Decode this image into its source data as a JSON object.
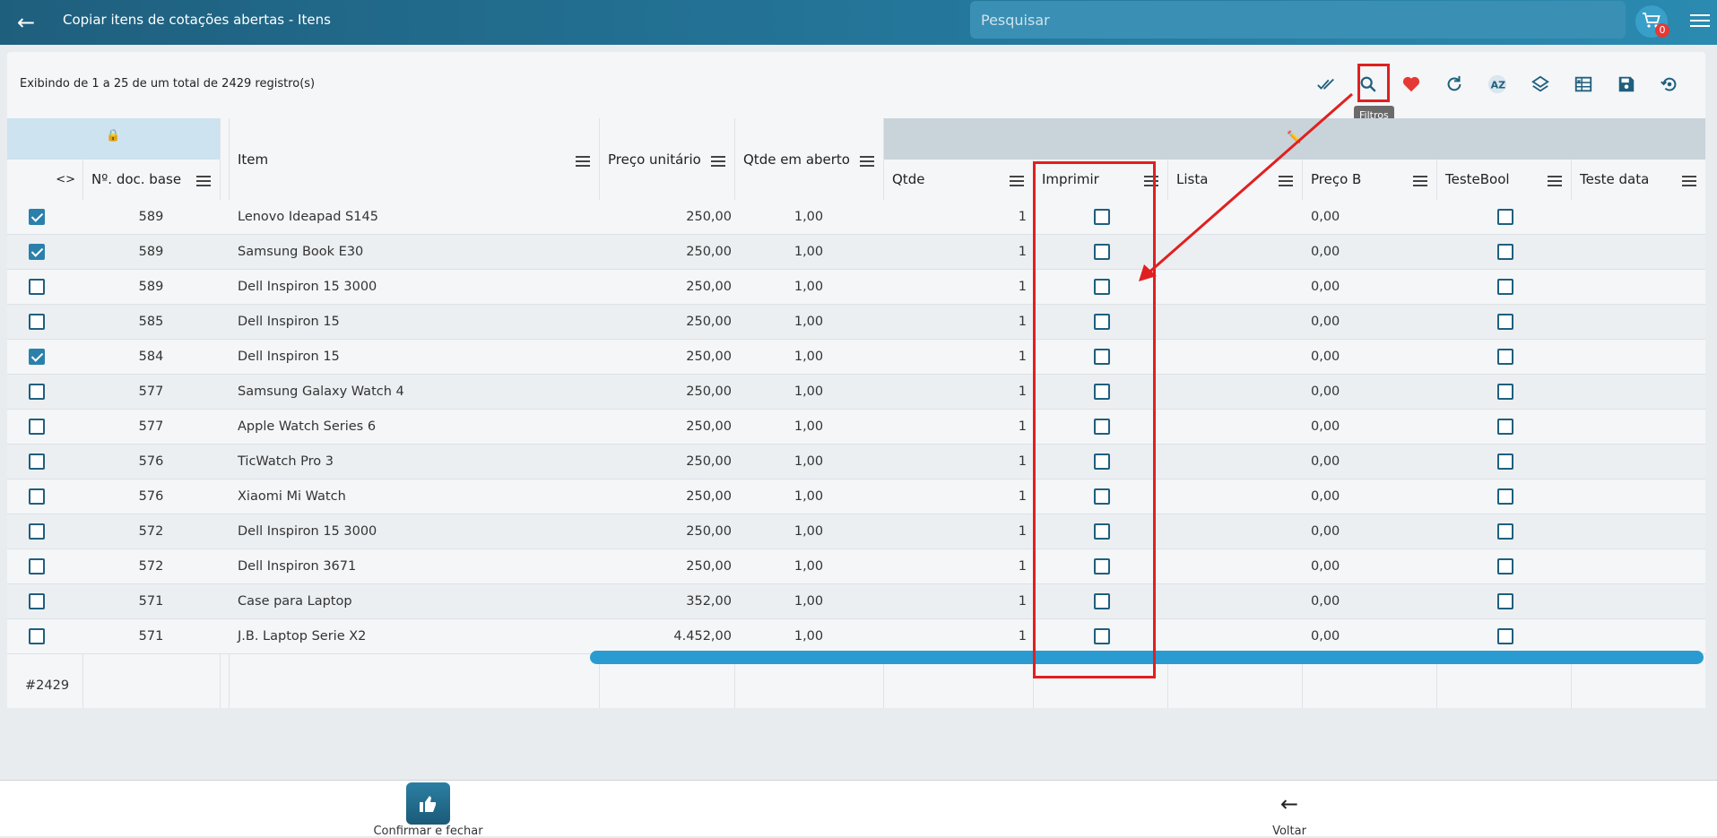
{
  "header": {
    "title": "Copiar itens de cotações abertas - Itens",
    "search_placeholder": "Pesquisar",
    "cart_count": "0"
  },
  "info": {
    "records": "Exibindo de 1 a 25 de um total de 2429 registro(s)"
  },
  "toolbar": {
    "items": [
      "check-all-icon",
      "search-icon",
      "heart-icon",
      "refresh-icon",
      "sort-az-icon",
      "layers-icon",
      "excel-icon",
      "save-icon",
      "restore-icon"
    ],
    "tooltip": "Filtros"
  },
  "groups": {
    "lock": "🔒",
    "edit": "✏️"
  },
  "columns": {
    "toggle": "<>",
    "doc": "Nº. doc. base",
    "item": "Item",
    "price": "Preço unitário",
    "open_qty": "Qtde em aberto",
    "qty": "Qtde",
    "print": "Imprimir",
    "list": "Lista",
    "price_b": "Preço B",
    "test_bool": "TesteBool",
    "test_date": "Teste data"
  },
  "rows": [
    {
      "checked": true,
      "doc": "589",
      "item": "Lenovo Ideapad S145",
      "price": "250,00",
      "open_qty": "1,00",
      "qty": "1",
      "price_b": "0,00"
    },
    {
      "checked": true,
      "doc": "589",
      "item": "Samsung Book E30",
      "price": "250,00",
      "open_qty": "1,00",
      "qty": "1",
      "price_b": "0,00"
    },
    {
      "checked": false,
      "doc": "589",
      "item": "Dell Inspiron 15 3000",
      "price": "250,00",
      "open_qty": "1,00",
      "qty": "1",
      "price_b": "0,00"
    },
    {
      "checked": false,
      "doc": "585",
      "item": "Dell Inspiron 15",
      "price": "250,00",
      "open_qty": "1,00",
      "qty": "1",
      "price_b": "0,00"
    },
    {
      "checked": true,
      "doc": "584",
      "item": "Dell Inspiron 15",
      "price": "250,00",
      "open_qty": "1,00",
      "qty": "1",
      "price_b": "0,00"
    },
    {
      "checked": false,
      "doc": "577",
      "item": "Samsung Galaxy Watch 4",
      "price": "250,00",
      "open_qty": "1,00",
      "qty": "1",
      "price_b": "0,00"
    },
    {
      "checked": false,
      "doc": "577",
      "item": "Apple Watch Series 6",
      "price": "250,00",
      "open_qty": "1,00",
      "qty": "1",
      "price_b": "0,00"
    },
    {
      "checked": false,
      "doc": "576",
      "item": "TicWatch Pro 3",
      "price": "250,00",
      "open_qty": "1,00",
      "qty": "1",
      "price_b": "0,00"
    },
    {
      "checked": false,
      "doc": "576",
      "item": "Xiaomi Mi Watch",
      "price": "250,00",
      "open_qty": "1,00",
      "qty": "1",
      "price_b": "0,00"
    },
    {
      "checked": false,
      "doc": "572",
      "item": "Dell Inspiron 15 3000",
      "price": "250,00",
      "open_qty": "1,00",
      "qty": "1",
      "price_b": "0,00"
    },
    {
      "checked": false,
      "doc": "572",
      "item": "Dell Inspiron 3671",
      "price": "250,00",
      "open_qty": "1,00",
      "qty": "1",
      "price_b": "0,00"
    },
    {
      "checked": false,
      "doc": "571",
      "item": "Case para Laptop",
      "price": "352,00",
      "open_qty": "1,00",
      "qty": "1",
      "price_b": "0,00"
    },
    {
      "checked": false,
      "doc": "571",
      "item": "J.B. Laptop Serie X2",
      "price": "4.452,00",
      "open_qty": "1,00",
      "qty": "1",
      "price_b": "0,00"
    }
  ],
  "footer": {
    "count": "#2429"
  },
  "bottom": {
    "confirm_label": "Confirmar e fechar",
    "back_label": "Voltar"
  },
  "colors": {
    "header": "#1f5f7e",
    "accent": "#2a80aa",
    "annotation": "#e02020",
    "heart": "#e53935"
  }
}
